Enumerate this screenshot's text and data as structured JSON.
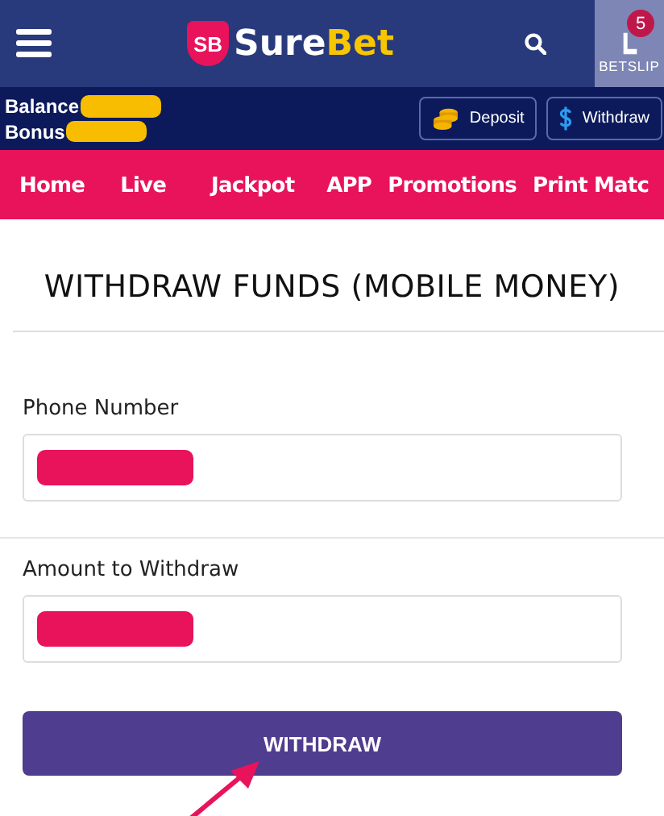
{
  "header": {
    "logo_badge": "SB",
    "wordmark_first": "Sure",
    "wordmark_second": "Bet",
    "betslip": {
      "count": "5",
      "label": "BETSLIP"
    }
  },
  "account_bar": {
    "balance_label": "Balance",
    "bonus_label": "Bonus",
    "buttons": [
      {
        "kind": "deposit",
        "label": "Deposit"
      },
      {
        "kind": "withdraw",
        "label": "Withdraw"
      }
    ]
  },
  "nav": [
    "Home",
    "Live",
    "Jackpot",
    "APP",
    "Promotions",
    "Print Matc"
  ],
  "title": "WITHDRAW FUNDS (MOBILE MONEY)",
  "fields": [
    {
      "label": "Phone Number"
    },
    {
      "label": "Amount to Withdraw"
    }
  ],
  "submit": "WITHDRAW"
}
